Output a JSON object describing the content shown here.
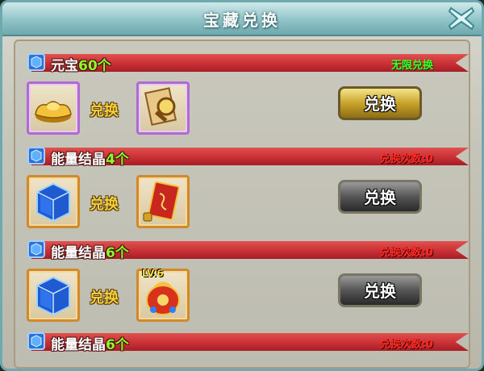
{
  "window": {
    "title": "宝藏兑换"
  },
  "colors": {
    "ribbon": "#c52e33",
    "count_green": "#8cff2a",
    "unlimited_green": "#40ff2a",
    "limit_red": "#ff2a22",
    "label_gold": "#f4d03f"
  },
  "entries": [
    {
      "currency_name": "元宝",
      "currency_count": "60个",
      "status": "无限兑换",
      "status_type": "unlimited",
      "cost_icon": "gold-ingot-icon",
      "exchange_label": "兑换",
      "reward_icon": "scroll-magnifier-icon",
      "reward_level": "",
      "button_label": "兑换",
      "button_state": "enabled"
    },
    {
      "currency_name": "能量结晶",
      "currency_count": "4个",
      "status": "兑换次数:0",
      "status_type": "limited",
      "cost_icon": "blue-crystal-cube-icon",
      "exchange_label": "兑换",
      "reward_icon": "red-talisman-card-icon",
      "reward_level": "",
      "button_label": "兑换",
      "button_state": "disabled"
    },
    {
      "currency_name": "能量结晶",
      "currency_count": "6个",
      "status": "兑换次数:0",
      "status_type": "limited",
      "cost_icon": "blue-crystal-cube-icon",
      "exchange_label": "兑换",
      "reward_icon": "red-treasure-bag-icon",
      "reward_level": "LV.6",
      "button_label": "兑换",
      "button_state": "disabled"
    },
    {
      "currency_name": "能量结晶",
      "currency_count": "6个",
      "status": "兑换次数:0",
      "status_type": "limited"
    }
  ]
}
